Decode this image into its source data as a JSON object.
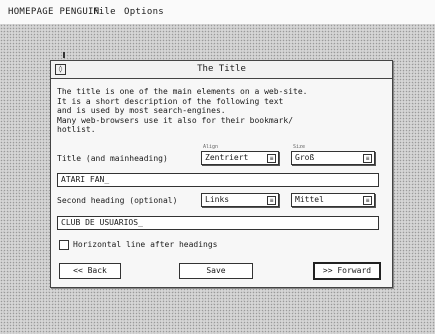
{
  "menubar": {
    "app": "HOMEPAGE PENGUIN",
    "file": "File",
    "options": "Options"
  },
  "window": {
    "close_glyph": "◊",
    "title": "The Title",
    "description": "The title is one of the main elements on a web-site.\nIt is a short description of the following text\nand is used by most search-engines.\nMany web-browsers use it also for their bookmark/\nhotlist."
  },
  "title_row": {
    "label": "Title (and mainheading)",
    "align_caption": "Align",
    "align_value": "Zentriert",
    "size_caption": "Size",
    "size_value": "Groß"
  },
  "title_field": {
    "value": "ATARI FAN_"
  },
  "second_row": {
    "label": "Second heading (optional)",
    "align_value": "Links",
    "size_value": "Mittel"
  },
  "second_field": {
    "value": "CLUB DE USUARIOS_"
  },
  "checkbox": {
    "label": "Horizontal line after headings",
    "checked": false
  },
  "buttons": {
    "back": "<< Back",
    "save": "Save",
    "forward": ">> Forward"
  },
  "icons": {
    "close": "close-icon",
    "dropdown": "chevron-down-icon"
  }
}
